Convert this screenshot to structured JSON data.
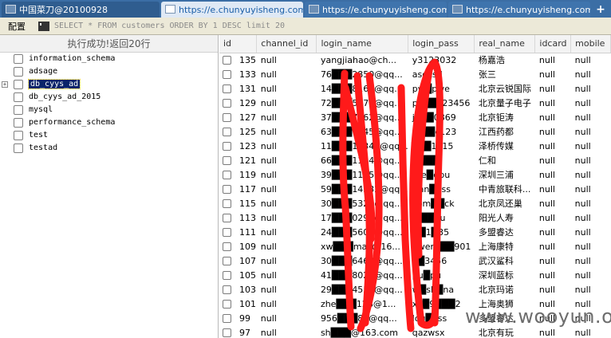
{
  "tabs": [
    {
      "label": "中国菜刀@20100928",
      "active": false
    },
    {
      "label": "https://e.chunyuyisheng.com...",
      "active": true
    },
    {
      "label": "https://e.chunyuyisheng.com...",
      "active": false
    },
    {
      "label": "https://e.chunyuyisheng.com...",
      "active": false
    }
  ],
  "new_tab_label": "+",
  "toolbar": {
    "config_label": "配置",
    "sql": "SELECT * FROM customers ORDER BY 1 DESC limit 20"
  },
  "left": {
    "header": "执行成功!返回20行",
    "databases": [
      {
        "name": "information_schema",
        "expander": ""
      },
      {
        "name": "adsage",
        "expander": ""
      },
      {
        "name": "db_cyys_ad",
        "expander": "+",
        "selected": true
      },
      {
        "name": "db_cyys_ad_2015",
        "expander": ""
      },
      {
        "name": "mysql",
        "expander": ""
      },
      {
        "name": "performance_schema",
        "expander": ""
      },
      {
        "name": "test",
        "expander": ""
      },
      {
        "name": "testad",
        "expander": ""
      }
    ]
  },
  "grid": {
    "columns": [
      "id",
      "channel_id",
      "login_name",
      "login_pass",
      "real_name",
      "idcard",
      "mobile"
    ],
    "rows": [
      [
        "135",
        "null",
        "yangjiahao@ch...",
        "y3123032",
        "杨嘉浩",
        "null",
        "null"
      ],
      [
        "133",
        "null",
        "76███2850@qq...",
        "asdzsd",
        "张三",
        "null",
        "null"
      ],
      [
        "131",
        "null",
        "14███8169@qq...",
        "pw█pwe",
        "北京云锐国际",
        "null",
        "null"
      ],
      [
        "129",
        "null",
        "72███5570@qq...",
        "pa██123456",
        "北京量子电子",
        "null",
        "null"
      ],
      [
        "127",
        "null",
        "37███7562@qq...",
        "ju██0869",
        "北京钜涛",
        "null",
        "null"
      ],
      [
        "125",
        "null",
        "63███7345@qq...",
        "zz██c123",
        "江西药都",
        "null",
        "null"
      ],
      [
        "123",
        "null",
        "11███10346@qq...",
        "a██1015",
        "泽桥传媒",
        "null",
        "null"
      ],
      [
        "121",
        "null",
        "66███1184@qq...",
        "████",
        "仁和",
        "null",
        "null"
      ],
      [
        "119",
        "null",
        "39███1105@qq...",
        "bre█dpu",
        "深圳三浦",
        "null",
        "null"
      ],
      [
        "117",
        "null",
        "59███14532@qq...",
        "rinn█ass",
        "中青旅联科...",
        "null",
        "null"
      ],
      [
        "115",
        "null",
        "30███5329@qq...",
        "com██ck",
        "北京凤还巢",
        "null",
        "null"
      ],
      [
        "113",
        "null",
        "17███0298@qq...",
        "re██ou",
        "阳光人寿",
        "null",
        "null"
      ],
      [
        "111",
        "null",
        "24███5606@qq...",
        "██1█35",
        "多盟睿达",
        "null",
        "null"
      ],
      [
        "109",
        "null",
        "xw███mail@16...",
        "qwer███901",
        "上海康特",
        "null",
        "null"
      ],
      [
        "107",
        "null",
        "30███6460@qq...",
        "1█3456",
        "武汉鲨科",
        "null",
        "null"
      ],
      [
        "105",
        "null",
        "41███8023@qq...",
        "pu█pu",
        "深圳蓝标",
        "null",
        "null"
      ],
      [
        "103",
        "null",
        "29███4556@qq...",
        "w█sh█na",
        "北京玛诺",
        "null",
        "null"
      ],
      [
        "101",
        "null",
        "zhe███128@1...",
        "xx█9███2",
        "上海奥狮",
        "null",
        "null"
      ],
      [
        "99",
        "null",
        "956███85@qq...",
        "log█ass",
        "多盟睿达",
        "null",
        "null"
      ],
      [
        "97",
        "null",
        "sh███@163.com",
        "qazwsx",
        "北京有玩",
        "null",
        "null"
      ]
    ]
  },
  "watermark": "www.wooyun.org",
  "colors": {
    "tabbar": "#3b6ea5",
    "selection": "#0a246a",
    "scribble": "#ff0000"
  }
}
